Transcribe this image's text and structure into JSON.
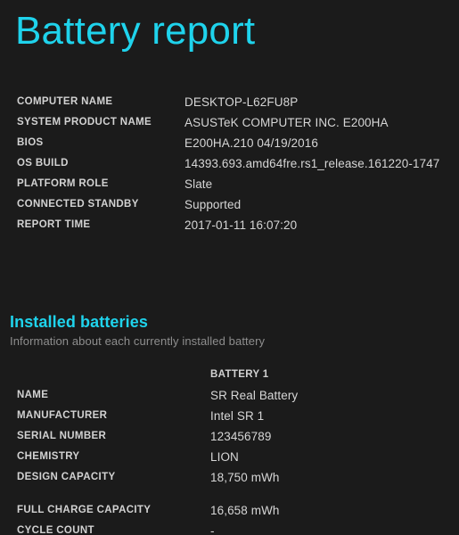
{
  "report": {
    "title": "Battery report"
  },
  "system_info": {
    "rows": [
      {
        "label": "COMPUTER NAME",
        "value": "DESKTOP-L62FU8P"
      },
      {
        "label": "SYSTEM PRODUCT NAME",
        "value": "ASUSTeK COMPUTER INC. E200HA"
      },
      {
        "label": "BIOS",
        "value": "E200HA.210 04/19/2016"
      },
      {
        "label": "OS BUILD",
        "value": "14393.693.amd64fre.rs1_release.161220-1747"
      },
      {
        "label": "PLATFORM ROLE",
        "value": "Slate"
      },
      {
        "label": "CONNECTED STANDBY",
        "value": "Supported"
      },
      {
        "label": "REPORT TIME",
        "value": "2017-01-11  16:07:20"
      }
    ]
  },
  "installed_batteries": {
    "heading": "Installed batteries",
    "subtitle": "Information about each currently installed battery",
    "column_header": "BATTERY 1",
    "rows": [
      {
        "label": "NAME",
        "value": "SR Real Battery"
      },
      {
        "label": "MANUFACTURER",
        "value": "Intel SR 1"
      },
      {
        "label": "SERIAL NUMBER",
        "value": "123456789"
      },
      {
        "label": "CHEMISTRY",
        "value": "LION"
      },
      {
        "label": "DESIGN CAPACITY",
        "value": "18,750 mWh"
      },
      {
        "label": "FULL CHARGE CAPACITY",
        "value": "16,658 mWh"
      },
      {
        "label": "CYCLE COUNT",
        "value": "-"
      }
    ]
  },
  "colors": {
    "background": "#1b1b1b",
    "accent": "#1fd3ec",
    "label_text": "#d2d2d2",
    "value_text": "#d6d6d6",
    "subtitle_text": "#8e8e8e"
  }
}
